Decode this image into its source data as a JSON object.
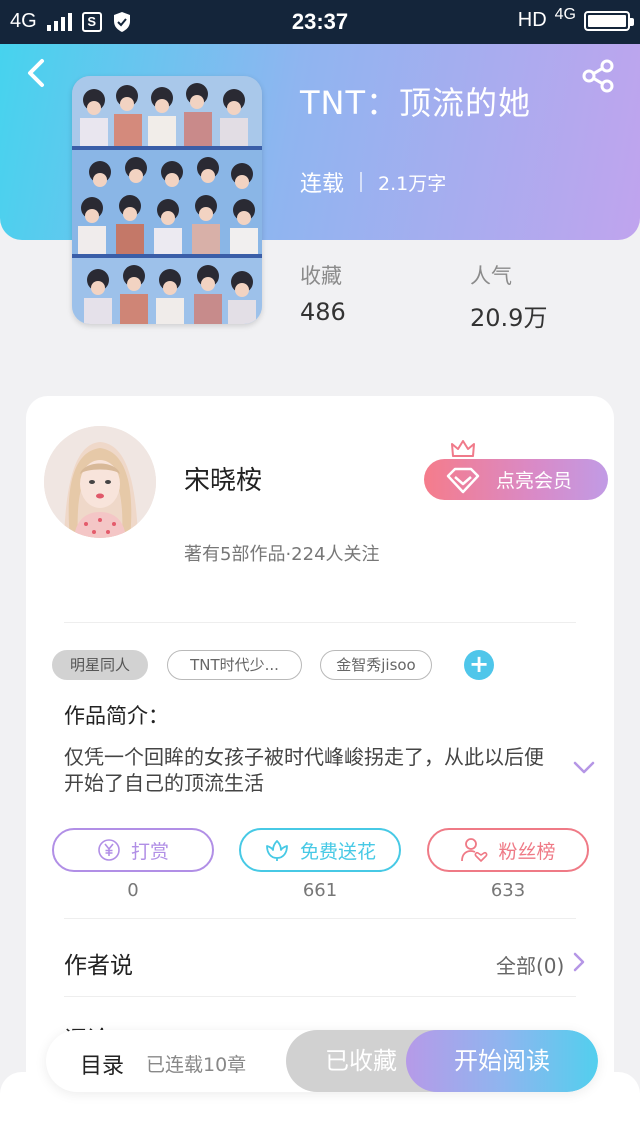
{
  "status_bar": {
    "network_left": "4G",
    "time": "23:37",
    "hd": "HD",
    "network_right": "4G",
    "battery_level": 1.0
  },
  "book": {
    "title": "TNT：顶流的她",
    "status": "连载",
    "word_count": "2.1万字",
    "collect_label": "收藏",
    "collect_value": "486",
    "popularity_label": "人气",
    "popularity_value": "20.9万"
  },
  "author": {
    "name": "宋晓桉",
    "stats": "著有5部作品·224人关注",
    "vip_label": "点亮会员"
  },
  "tags": [
    "明星同人",
    "TNT时代少...",
    "金智秀jisoo"
  ],
  "intro": {
    "label": "作品简介：",
    "text": "仅凭一个回眸的女孩子被时代峰峻拐走了，从此以后便开始了自己的顶流生活"
  },
  "actions": [
    {
      "label": "打赏",
      "count": "0",
      "color": "#b18fe6",
      "icon": "yen-coin-icon"
    },
    {
      "label": "免费送花",
      "count": "661",
      "color": "#47c9e5",
      "icon": "flower-icon"
    },
    {
      "label": "粉丝榜",
      "count": "633",
      "color": "#ef7a86",
      "icon": "fan-user-heart-icon"
    }
  ],
  "author_says": {
    "title": "作者说",
    "all_label": "全部(0)"
  },
  "comments_peek": "评论",
  "bottom_bar": {
    "toc_label": "目录",
    "chapter_count": "已连载10章",
    "collected_label": "已收藏",
    "read_label": "开始阅读"
  },
  "colors": {
    "header_gradient_start": "#46d3ee",
    "header_gradient_end": "#c0a4ee",
    "vip_gradient_start": "#f57c8b",
    "vip_gradient_end": "#c19be5"
  }
}
